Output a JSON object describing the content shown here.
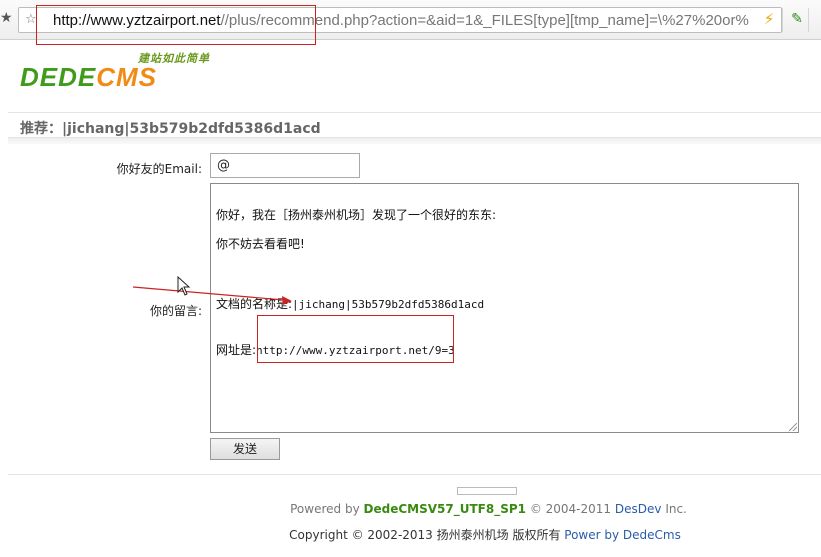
{
  "browser": {
    "url_domain": "http://www.yztzairport.net",
    "url_path": "//plus/recommend.php?action=&aid=1&_FILES[type][tmp_name]=\\%27%20or%",
    "icons": [
      "star-icon",
      "bookmark-star-icon",
      "lightning-bolt-icon",
      "pin-icon"
    ]
  },
  "logo": {
    "slogan": "建站如此简单",
    "text_dede": "DEDE",
    "text_cms": "CMS"
  },
  "page": {
    "title": "推荐：|jichang|53b579b2dfd5386d1acd"
  },
  "form": {
    "email_label": "你好友的Email:",
    "email_value": "@",
    "message_label": "你的留言:",
    "message_lines": [
      "你好，我在［扬州泰州机场］发现了一个很好的东东:",
      "你不妨去看看吧!"
    ],
    "doc_name_label": "文档的名称是:",
    "doc_name_value": "|jichang|53b579b2dfd5386d1acd",
    "url_label": "网址是:",
    "url_value": "http://www.yztzairport.net/9=3",
    "send_label": "发送"
  },
  "footer": {
    "powered_prefix": "Powered by",
    "powered_version": "DedeCMSV57_UTF8_SP1",
    "powered_years": "© 2004-2011",
    "powered_company": "DesDev",
    "powered_suffix": "Inc.",
    "copyright_text": "Copyright © 2002-2013 扬州泰州机场 版权所有",
    "copyright_link": "Power by DedeCms"
  },
  "colors": {
    "annotation_red": "#cc2222",
    "logo_green": "#3f9b1a",
    "logo_orange": "#f08b16",
    "link_blue": "#2a5ca8"
  }
}
